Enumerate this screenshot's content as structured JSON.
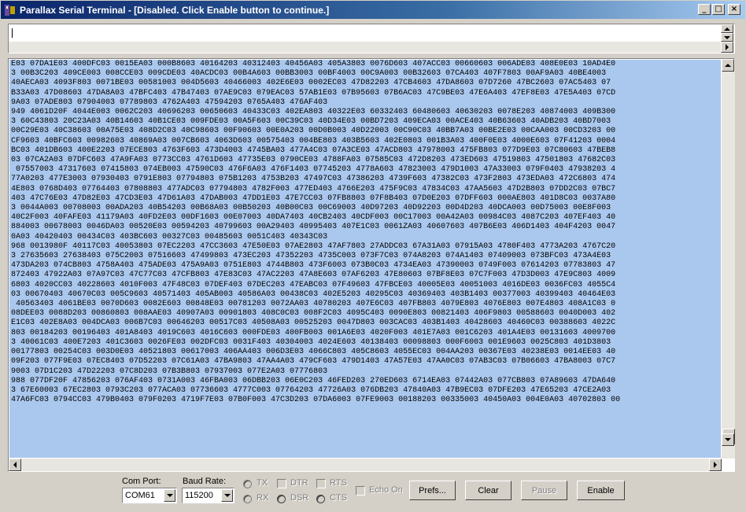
{
  "window": {
    "title": "Parallax Serial Terminal - [Disabled. Click Enable button to continue.]",
    "minimize_glyph": "_",
    "maximize_glyph": "□",
    "close_glyph": "×"
  },
  "input": {
    "value": ""
  },
  "output": {
    "selection_color": "#aac8ee",
    "lines": [
      "E03 07DA1E03 400DFC03 0015EA03 000B8603 40164203 40312403 40456A03 405A3803 0076D603 407ACC03 00660603 006ADE03 408E0E03 10AD4E0",
      "3 00B3C203 409CE003 008CCE03 009CDE03 40ACDC03 00B4A603 00BB3003 00BF4003 00C9A003 00B32603 07CA403 407F7803 00AF9A03 40BE4003",
      "40AECA03 4093F803 0071BE03 00581003 004D5603 40466003 402E6E03 0002EC03 47D82203 47CB4603 47DA8603 07D7260 47BC2603 07AC5403 07",
      "B33A03 47D08603 47DA8A03 47BFC403 47B47403 07AE9C03 079EAC03 57AB1E03 07B95603 07B6AC03 47C9BE03 47E6A403 47EF8E03 47E5A403 07CD",
      "9A03 07ADE803 07904003 07789803 4762A403 47594203 0765A403 476AF403",
      "949 4061D20F 4044E003 0062C203 40696203 00650603 40433C03 402EA803 40322E03 60332403 60480603 40630203 0078E203 40874003 409B300",
      "3 60C43803 20C23A03 40B14603 40B1CE03 009FDE03 00A5F603 00C39C03 40D34E03 00BD7203 409ECA03 00ACE403 40B63603 40ADB203 40BD7003",
      "00C29E03 40C38603 00A75E03 408D2C03 40C98603 00F90603 00E0A203 00D0B003 40D22003 00C90C03 40BB7A03 00BE2E03 00CAA003 00CD3203 00",
      "CF9603 40BFC603 00982603 40869A03 007CB603 4063D603 00575403 004BE803 403B5603 402E0803 001B3A03 400F0E03 4000E603 07F41203 0004",
      "BC03 401DB603 400E2203 07ECE803 4763F603 473D4003 4745BA03 477A4C03 07A3CE03 47ACD803 47978003 475FB803 077D9E03 07C80603 47BEB8",
      "03 07CA2A03 07DFC603 47A9FA03 0773CC03 4761D603 47735E03 0790CE03 4788FA03 07585C03 472D8203 473ED603 47519803 47501803 47682C03",
      " 07557003 47317603 07415803 074EB003 47590C03 476F6A03 476F1403 07745203 4778A603 47823003 479D1003 47A33003 079F0403 47938203 4",
      "77A0203 477E3003 07930403 0791E803 07794803 075B1203 4753B203 47497C03 47386203 4739F603 47382C03 473F2803 473EDA03 472C6803 474",
      "4E803 0768D403 07764403 07808803 477ADC03 07794803 4782F003 477ED403 4766E203 475F9C03 47834C03 47AA5603 47D2B803 07DD2C03 07BC7",
      "403 47C76E03 47D82E03 47CD3E03 47D61A03 47DAB003 47DD1E03 47E7CC03 07FB8803 07F8B403 07D0E203 07DFF603 000AE803 401D8C03 0037A80",
      "3 0044A003 00708003 00ADA203 40B54203 00B68A03 00B50203 40B00C03 00C69003 40D97203 40D92203 00D4D203 40DCA003 00D75003 00E8F003",
      "40C2F003 40FAFE03 41179A03 40FD2E03 00DF1603 00E07003 40DA7403 40CB2403 40CDF003 00C17003 00A42A03 00984C03 4087C203 407EF403 40",
      "884003 00678003 0046DA03 00520E03 00594203 40799603 00A29403 40995403 407E1C03 0061ZA03 40607603 407B6E03 406D1403 404F4203 0047",
      "0A03 40420403 00434C03 403BC603 00327C03 00485603 0051C403 40343C03",
      "968 0013980F 40117C03 40053803 07EC2203 47CC3603 47E50E03 07AE2803 47AF7803 27ADDC03 67A31A03 07915A03 4780F403 4773A203 4767C20",
      "3 27635603 27638403 075C2003 07516603 47499803 473EC203 47352203 4735C003 073F7C03 074A8203 074A1403 07409003 073BFC03 473A4E03",
      "473DA203 074CB803 4758A403 475ADE03 475A9A03 0751E803 4744B803 473F6003 073B0C03 4734EA03 47390003 0749F003 07614203 07783803 47",
      "872403 47922A03 07A97C03 47C77C03 47CFB803 47E83C03 47AC2203 47A8E603 07AF6203 47E80603 07BF8E03 07C7F003 47D3D003 47E9C803 4009",
      "6803 4020CC03 40228603 4010F003 47F48C03 07DEF403 07DEC203 47EABC03 07F49603 47FBCE03 40005E03 40051003 4016DE03 0036FC03 4055C4",
      "03 00670403 40670C03 005C9603 40571403 405AB003 40586A03 00438C03 402E5203 40295C03 40369403 403B1403 00377003 40399403 40464E03",
      " 40563403 4061BE03 0070D603 0082E603 00848E03 00781203 0072AA03 40780203 407E6C03 407FB803 4079E803 4076E803 007E4803 408A1C03 0",
      "08DEE03 0088D203 00860803 008AAE03 40907A03 00901803 408C0C03 008F2C03 4095C403 0090E803 00821403 406F9803 00588603 0040D003 402",
      "E1C03 402E8A03 004DCA03 006B7C03 00646203 00517C03 40508A03 00525203 0047D803 003CAC03 403B1403 40428603 40460C03 00388603 4022C",
      "803 00184203 00196403 401A8403 4019C603 4016C603 000FDE03 400FB003 001A6E03 4020F003 401E7A03 001C6203 401A4E03 00131603 4009700",
      "3 40061C03 400E7203 401C3603 0026FE03 002DFC03 0031F403 40304003 4024E603 40138403 00098803 000F6003 001E9603 0025C803 401D3803",
      "00177803 00254C03 003D0E03 40521803 00617003 406AA403 006D3E03 4066C803 405C8603 4055EC03 004AA203 00367E03 40238E03 0014EE03 40",
      "09F203 077F9E03 07EC8403 07D52203 07C61A03 47BA9803 47AA4A03 479CF603 479D1403 47A57E03 47AA0C03 07AB3C03 07B06603 47BA8003 07C7",
      "9003 07D1C203 47D22203 07C8D203 07B3B803 07937003 077E2A03 07776803",
      "988 077DF20F 47856203 076AF403 0731A003 46FBA003 06DBB203 06E0C203 46FED203 270ED603 6714EA03 07442A03 077CB803 07A89603 47DA640",
      "3 67E60003 67EC2803 0793C203 077ACA03 07736603 4777C003 07764203 47726A03 076DB203 47840A03 47B9EC03 07DFE203 47E65203 47CE2A03",
      "47A6FC03 0794CC03 479B0403 079F0203 4719F7E03 07B0F003 47C3D203 07DA6003 07FE9003 00188203 00335003 40450A03 004E0A03 40702803 00"
    ]
  },
  "controls": {
    "com_port_label": "Com Port:",
    "com_port_value": "COM61",
    "baud_rate_label": "Baud Rate:",
    "baud_rate_value": "115200",
    "tx_label": "TX",
    "rx_label": "RX",
    "dtr_label": "DTR",
    "dsr_label": "DSR",
    "rts_label": "RTS",
    "cts_label": "CTS",
    "echo_on_label": "Echo On",
    "prefs_button": "Prefs...",
    "clear_button": "Clear",
    "pause_button": "Pause",
    "enable_button": "Enable"
  }
}
